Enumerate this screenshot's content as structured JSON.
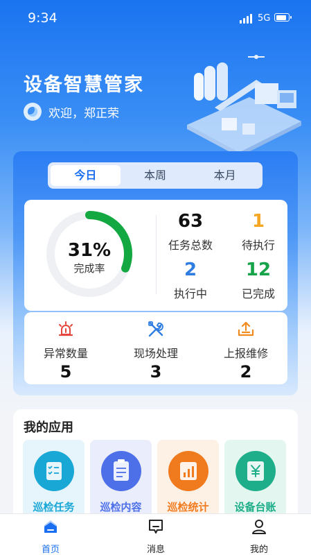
{
  "status_bar": {
    "time": "9:34",
    "network": "5G"
  },
  "header": {
    "title": "设备智慧管家",
    "welcome": "欢迎，郑正荣"
  },
  "period_tabs": [
    {
      "label": "今日",
      "active": true
    },
    {
      "label": "本周",
      "active": false
    },
    {
      "label": "本月",
      "active": false
    }
  ],
  "summary": {
    "completion_rate": "31%",
    "completion_rate_value": 0.31,
    "completion_label": "完成率",
    "total": {
      "value": "63",
      "label": "任务总数",
      "color": "#111111"
    },
    "pending": {
      "value": "1",
      "label": "待执行",
      "color": "#f5a623"
    },
    "in_progress": {
      "value": "2",
      "label": "执行中",
      "color": "#2f7de1"
    },
    "completed": {
      "value": "12",
      "label": "已完成",
      "color": "#16a34a"
    }
  },
  "issues": [
    {
      "label": "异常数量",
      "value": "5",
      "icon": "alarm-light-icon"
    },
    {
      "label": "现场处理",
      "value": "3",
      "icon": "tools-icon"
    },
    {
      "label": "上报维修",
      "value": "2",
      "icon": "upload-tray-icon"
    }
  ],
  "apps": {
    "title": "我的应用",
    "items": [
      {
        "label": "巡检任务",
        "icon": "checklist-icon",
        "color": "#19a7d6",
        "bg": "#e6f4fb"
      },
      {
        "label": "巡检内容",
        "icon": "clipboard-icon",
        "color": "#4d6fe8",
        "bg": "#eaeefc"
      },
      {
        "label": "巡检统计",
        "icon": "bar-chart-icon",
        "color": "#f07b1f",
        "bg": "#fdf0e4"
      },
      {
        "label": "设备台账",
        "icon": "yuan-icon",
        "color": "#1fae8a",
        "bg": "#e3f6ef"
      }
    ]
  },
  "tabbar": [
    {
      "label": "首页",
      "active": true
    },
    {
      "label": "消息",
      "active": false
    },
    {
      "label": "我的",
      "active": false
    }
  ]
}
